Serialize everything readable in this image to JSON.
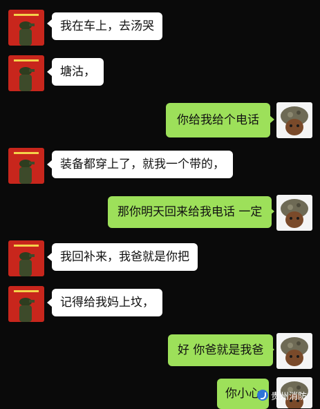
{
  "messages": [
    {
      "side": "left",
      "text": "我在车上，去汤哭"
    },
    {
      "side": "left",
      "text": "塘沽，"
    },
    {
      "side": "right",
      "text": "你给我给个电话"
    },
    {
      "side": "left",
      "text": "装备都穿上了，就我一个带的，"
    },
    {
      "side": "right",
      "text": "那你明天回来给我电话 一定"
    },
    {
      "side": "left",
      "text": "我回补来，我爸就是你把"
    },
    {
      "side": "left",
      "text": "记得给我妈上坟，"
    },
    {
      "side": "right",
      "text": "好 你爸就是我爸"
    },
    {
      "side": "right",
      "text": "你小心"
    }
  ],
  "watermark": {
    "text": "贵州消防",
    "icon": "wechat-official-icon"
  },
  "colors": {
    "background": "#0a0a0a",
    "left_bubble": "#ffffff",
    "right_bubble": "#9de05a",
    "left_avatar": "#c8261c"
  }
}
